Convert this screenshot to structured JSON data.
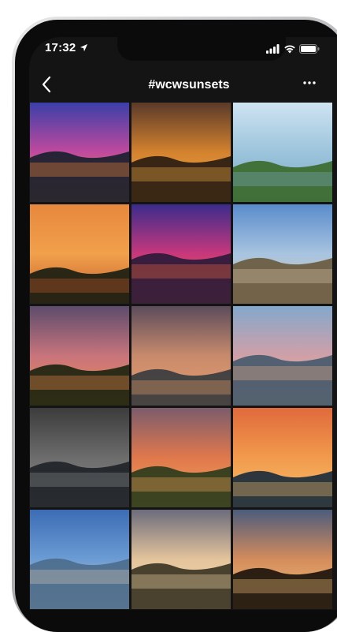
{
  "status_bar": {
    "time": "17:32"
  },
  "header": {
    "title": "#wcwsunsets"
  },
  "icons": {
    "back": "chevron-left-icon",
    "more": "more-horizontal-icon",
    "signal": "cellular-signal-icon",
    "wifi": "wifi-icon",
    "battery": "battery-icon",
    "location": "location-arrow-icon"
  },
  "grid": {
    "columns": 3,
    "posts": [
      {
        "sky": [
          "#3a3fa8",
          "#c04a9e",
          "#f08a3c"
        ],
        "ground": "#1a1f2e"
      },
      {
        "sky": [
          "#5a3a2a",
          "#d4822e",
          "#f3b04a"
        ],
        "ground": "#2a1c10"
      },
      {
        "sky": [
          "#cfe3f2",
          "#9cc4dc",
          "#7aa8c4"
        ],
        "ground": "#3c6a2c"
      },
      {
        "sky": [
          "#e7883e",
          "#f1a04b",
          "#c25a2c"
        ],
        "ground": "#1a1e12"
      },
      {
        "sky": [
          "#3b2c8c",
          "#c8387c",
          "#f26a3e"
        ],
        "ground": "#2c1a3a"
      },
      {
        "sky": [
          "#5a8ccc",
          "#a8c4e0",
          "#d9c7a8"
        ],
        "ground": "#6a5a40"
      },
      {
        "sky": [
          "#5c4c6c",
          "#c8747c",
          "#f08c4c"
        ],
        "ground": "#1c2410"
      },
      {
        "sky": [
          "#5c4c5c",
          "#c88a6c",
          "#e8a06c"
        ],
        "ground": "#3a3c40"
      },
      {
        "sky": [
          "#84a8cc",
          "#cfa0a8",
          "#e8b08c"
        ],
        "ground": "#485a6c"
      },
      {
        "sky": [
          "#3c3c3c",
          "#6c6c6c",
          "#8c8c8c"
        ],
        "ground": "#202428"
      },
      {
        "sky": [
          "#7c5c6c",
          "#e0784c",
          "#f4a45c"
        ],
        "ground": "#2c3c1c"
      },
      {
        "sky": [
          "#e06a3c",
          "#f29a4c",
          "#f4c06c"
        ],
        "ground": "#1c2c3c"
      },
      {
        "sky": [
          "#3c6cb4",
          "#6c9cd4",
          "#d4c4b4"
        ],
        "ground": "#4c6c8c"
      },
      {
        "sky": [
          "#6c6c7c",
          "#e4c49c",
          "#f4dcac"
        ],
        "ground": "#3c3424"
      },
      {
        "sky": [
          "#4c5c7c",
          "#d48c5c",
          "#f4c47c"
        ],
        "ground": "#1c140c"
      }
    ]
  }
}
